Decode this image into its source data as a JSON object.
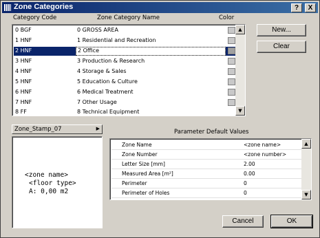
{
  "window": {
    "title": "Zone Categories"
  },
  "titlebar": {
    "help": "?",
    "close": "X"
  },
  "headers": {
    "code": "Category Code",
    "name": "Zone Category Name",
    "color": "Color"
  },
  "categories": [
    {
      "code": "0 BGF",
      "name": "0 GROSS AREA"
    },
    {
      "code": "1 HNF",
      "name": "1 Residential and Recreation"
    },
    {
      "code": "2 HNF",
      "name": "2 Office"
    },
    {
      "code": "3 HNF",
      "name": "3 Production & Research"
    },
    {
      "code": "4 HNF",
      "name": "4 Storage & Sales"
    },
    {
      "code": "5 HNF",
      "name": "5 Education & Culture"
    },
    {
      "code": "6 HNF",
      "name": "6 Medical Treatment"
    },
    {
      "code": "7 HNF",
      "name": "7 Other Usage"
    },
    {
      "code": "8 FF",
      "name": "8 Technical Equipment"
    }
  ],
  "selected_index": 2,
  "buttons": {
    "new": "New...",
    "clear": "Clear",
    "cancel": "Cancel",
    "ok": "OK"
  },
  "stamp": {
    "selected": "Zone_Stamp_07"
  },
  "preview": {
    "line1": "<zone name>",
    "line2": "<floor type>",
    "line3": "A: 0,00 m2"
  },
  "params": {
    "title": "Parameter Default Values",
    "rows": [
      {
        "key": "Zone Name",
        "value": "<zone name>"
      },
      {
        "key": "Zone Number",
        "value": "<zone number>"
      },
      {
        "key": "Letter Size [mm]",
        "value": "2.00"
      },
      {
        "key": "Measured Area [m²]",
        "value": "0.00"
      },
      {
        "key": "Perimeter",
        "value": "0"
      },
      {
        "key": "Perimeter of Holes",
        "value": "0"
      }
    ]
  },
  "colors": {
    "title_bar": "#0a246a",
    "selection": "#0a246a",
    "dialog_bg": "#d4d0c8"
  },
  "icons": [
    "zone-categories-app-icon",
    "help-icon",
    "close-icon",
    "scroll-up-icon",
    "scroll-down-icon",
    "dropdown-arrow-icon"
  ]
}
